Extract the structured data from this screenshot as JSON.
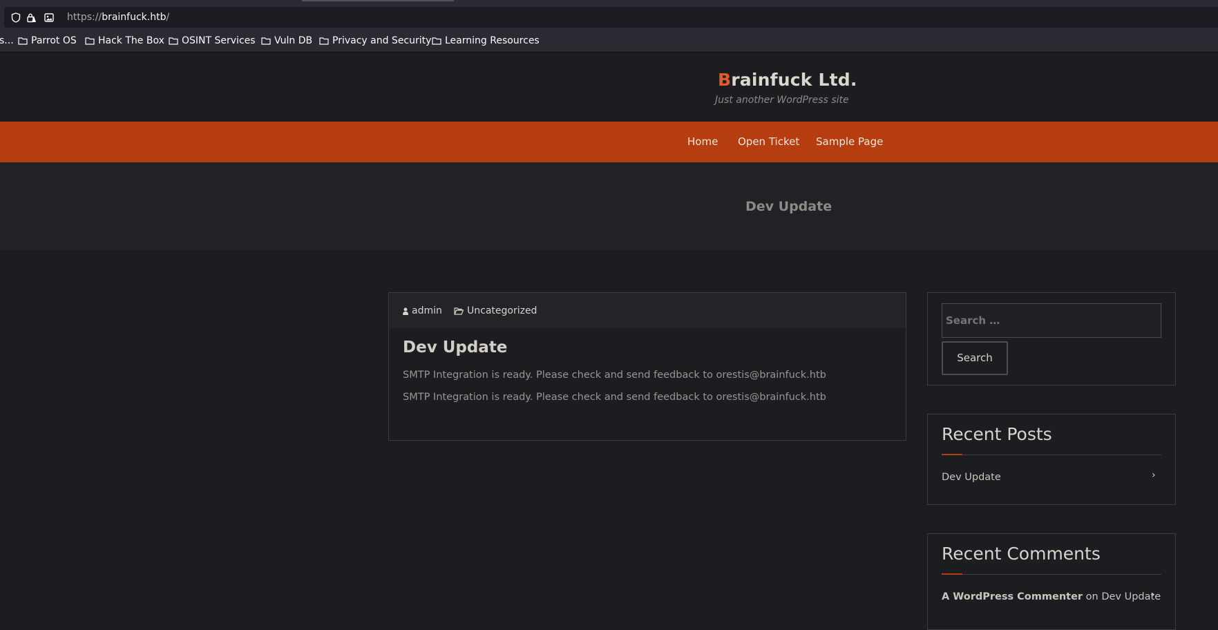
{
  "browser": {
    "url_scheme": "https://",
    "url_host": "brainfuck.htb",
    "url_path": "/",
    "bookmarks": [
      {
        "label": "s..."
      },
      {
        "label": "Parrot OS"
      },
      {
        "label": "Hack The Box"
      },
      {
        "label": "OSINT Services"
      },
      {
        "label": "Vuln DB"
      },
      {
        "label": "Privacy and Security"
      },
      {
        "label": "Learning Resources"
      }
    ],
    "icons": [
      "shield-icon",
      "lock-warning-icon",
      "page-image-icon",
      "folder-icon"
    ]
  },
  "site": {
    "brand_first": "B",
    "brand_rest": "rainfuck Ltd.",
    "tagline": "Just another WordPress site",
    "accent_color": "#b63d10",
    "nav": [
      {
        "label": "Home"
      },
      {
        "label": "Open Ticket"
      },
      {
        "label": "Sample Page"
      }
    ],
    "banner_title": "Dev Update"
  },
  "post": {
    "author": "admin",
    "category": "Uncategorized",
    "title": "Dev Update",
    "paragraphs": [
      "SMTP Integration is ready. Please check and send feedback to orestis@brainfuck.htb",
      "SMTP Integration is ready. Please check and send feedback to orestis@brainfuck.htb"
    ]
  },
  "sidebar": {
    "search_placeholder": "Search …",
    "search_button": "Search",
    "recent_posts_title": "Recent Posts",
    "recent_posts": [
      {
        "label": "Dev Update"
      }
    ],
    "recent_comments_title": "Recent Comments",
    "recent_comments": [
      {
        "author": "A WordPress Commenter",
        "joiner": "on",
        "post": "Dev Update"
      }
    ]
  }
}
